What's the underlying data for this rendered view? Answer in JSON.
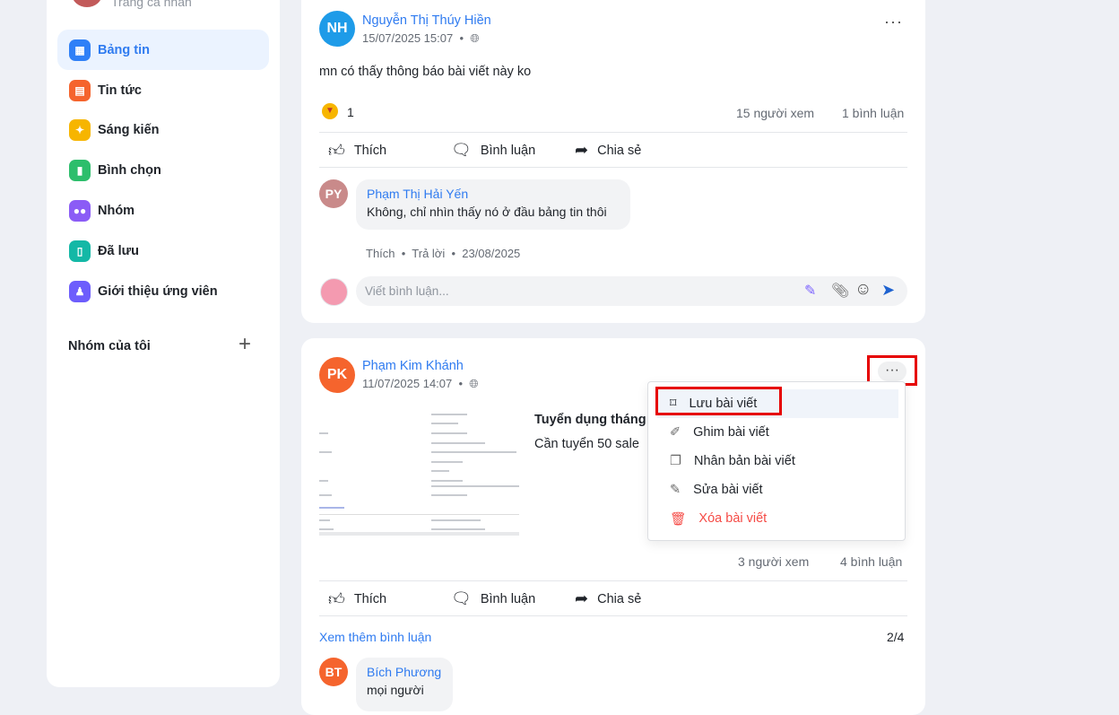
{
  "sidebar": {
    "profile_label": "Trang cá nhân",
    "items": [
      {
        "label": "Bảng tin",
        "icon": "newsfeed-icon",
        "color": "#2f80f7",
        "active": true
      },
      {
        "label": "Tin tức",
        "icon": "news-icon",
        "color": "#f5642d"
      },
      {
        "label": "Sáng kiến",
        "icon": "lightbulb-icon",
        "color": "#f7b500"
      },
      {
        "label": "Bình chọn",
        "icon": "poll-icon",
        "color": "#2dbe6c"
      },
      {
        "label": "Nhóm",
        "icon": "group-icon",
        "color": "#8b5cf6"
      },
      {
        "label": "Đã lưu",
        "icon": "bookmark-icon",
        "color": "#14b8a6"
      },
      {
        "label": "Giới thiệu ứng viên",
        "icon": "referral-icon",
        "color": "#6d5dfc"
      }
    ],
    "my_groups": "Nhóm của tôi"
  },
  "posts": [
    {
      "initials": "NH",
      "avatar_color": "#1e9be8",
      "author": "Nguyễn Thị Thúy Hiền",
      "time": "15/07/2025 15:07",
      "content": "mn có thấy thông báo bài viết này ko",
      "reaction_count": "1",
      "views": "15 người xem",
      "comments": "1 bình luận",
      "comment": {
        "initials": "PY",
        "avatar_color": "#c98a8a",
        "author": "Phạm Thị Hải Yến",
        "text": "Không, chỉ nhìn thấy nó ở đầu bảng tin thôi",
        "like": "Thích",
        "reply": "Trả lời",
        "date": "23/08/2025"
      },
      "comment_placeholder": "Viết bình luận..."
    },
    {
      "initials": "PK",
      "avatar_color": "#f5642d",
      "author": "Phạm Kim Khánh",
      "time": "11/07/2025 14:07",
      "title": "Tuyển dụng tháng",
      "content": "Cần tuyển 50 sale",
      "views": "3 người xem",
      "comments": "4 bình luận",
      "more_comments": "Xem thêm bình luận",
      "comment_page": "2/4",
      "comment": {
        "initials": "BT",
        "avatar_color": "#f5642d",
        "author": "Bích Phương",
        "text": "mọi người"
      }
    }
  ],
  "actions": {
    "like": "Thích",
    "comment": "Bình luận",
    "share": "Chia sẻ"
  },
  "menu": [
    {
      "label": "Lưu bài viết",
      "icon": "bookmark-icon"
    },
    {
      "label": "Ghim bài viết",
      "icon": "pin-icon"
    },
    {
      "label": "Nhân bản bài viết",
      "icon": "duplicate-icon"
    },
    {
      "label": "Sửa bài viết",
      "icon": "edit-icon"
    },
    {
      "label": "Xóa bài viết",
      "icon": "trash-icon",
      "color": "#f54a45"
    }
  ]
}
